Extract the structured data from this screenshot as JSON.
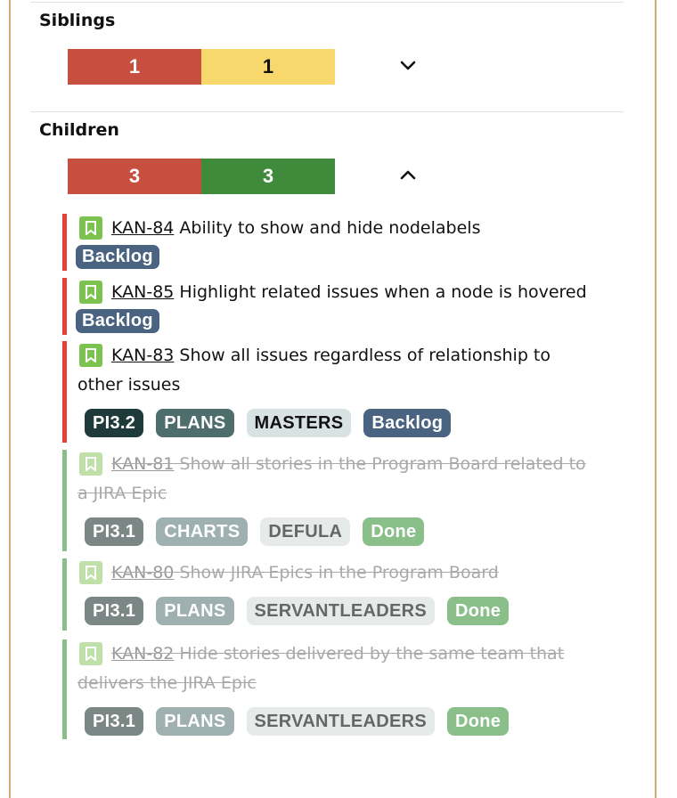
{
  "siblings": {
    "title": "Siblings",
    "counts": [
      {
        "value": "1",
        "color": "#c64f40"
      },
      {
        "value": "1",
        "color": "#f8d86c"
      }
    ]
  },
  "children": {
    "title": "Children",
    "counts": [
      {
        "value": "3",
        "color": "#c64f40"
      },
      {
        "value": "3",
        "color": "#3f8a3b"
      }
    ],
    "issues": [
      {
        "key": "KAN-84",
        "summary": "Ability to show and hide nodelabels",
        "tags": [
          "Backlog"
        ],
        "done": false
      },
      {
        "key": "KAN-85",
        "summary": "Highlight related issues when a node is hovered",
        "tags": [
          "Backlog"
        ],
        "done": false
      },
      {
        "key": "KAN-83",
        "summary_line1": "Show all issues regardless of relationship to",
        "summary_line2": "other issues",
        "tags": [
          "PI3.2",
          "PLANS",
          "MASTERS",
          "Backlog"
        ],
        "done": false
      },
      {
        "key": "KAN-81",
        "summary_line1": "Show all stories in the Program Board related to",
        "summary_line2": "a JIRA Epic",
        "tags": [
          "PI3.1",
          "CHARTS",
          "DEFULA",
          "Done"
        ],
        "done": true
      },
      {
        "key": "KAN-80",
        "summary": "Show JIRA Epics in the Program Board",
        "tags": [
          "PI3.1",
          "PLANS",
          "SERVANTLEADERS",
          "Done"
        ],
        "done": true
      },
      {
        "key": "KAN-82",
        "summary_line1": "Hide stories delivered by the same team that",
        "summary_line2": "delivers the JIRA Epic",
        "tags": [
          "PI3.1",
          "PLANS",
          "SERVANTLEADERS",
          "Done"
        ],
        "done": true
      }
    ]
  },
  "icons": {
    "issue_type": "bookmark-icon",
    "siblings_toggle": "chevron-down-icon",
    "children_toggle": "chevron-up-icon"
  }
}
